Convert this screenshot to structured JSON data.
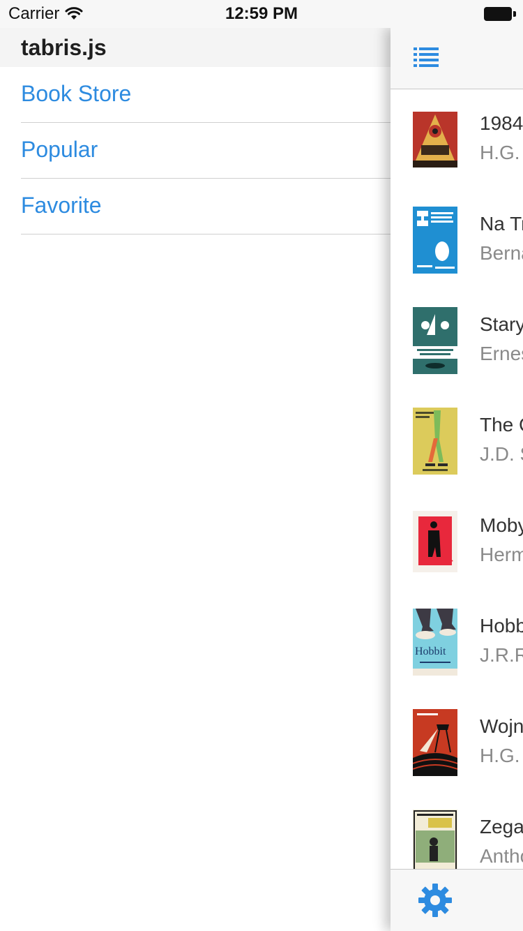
{
  "status_bar": {
    "carrier": "Carrier",
    "time": "12:59 PM",
    "wifi_icon": "wifi-icon",
    "battery_icon": "battery-icon"
  },
  "drawer": {
    "title": "tabris.js",
    "items": [
      {
        "label": "Book Store"
      },
      {
        "label": "Popular"
      },
      {
        "label": "Favorite"
      }
    ]
  },
  "page": {
    "menu_icon": "list-menu-icon",
    "settings_icon": "gear-icon",
    "books": [
      {
        "title": "1984",
        "author": "H.G."
      },
      {
        "title": "Na Tr",
        "author": "Berna"
      },
      {
        "title": "Stary",
        "author": "Ernes"
      },
      {
        "title": "The C",
        "author": "J.D. S"
      },
      {
        "title": "Moby",
        "author": "Herm"
      },
      {
        "title": "Hobb",
        "author": "J.R.R"
      },
      {
        "title": "Wojn",
        "author": "H.G."
      },
      {
        "title": "Zega",
        "author": "Antho"
      }
    ]
  },
  "colors": {
    "accent": "#2d8be0",
    "header_bg": "#f4f4f4",
    "divider": "#cfcfcf"
  }
}
